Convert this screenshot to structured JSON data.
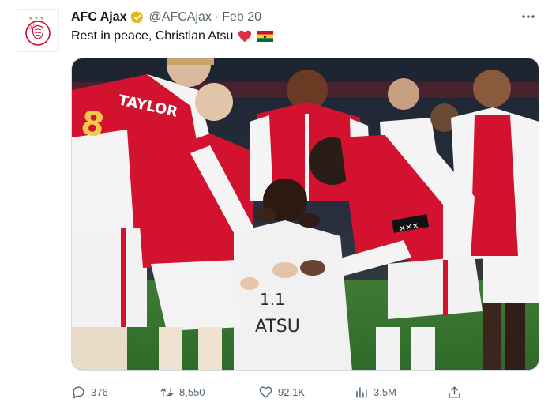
{
  "account": {
    "display_name": "AFC Ajax",
    "handle": "@AFCAjax",
    "separator": "·",
    "date": "Feb 20",
    "avatar_icon": "ajax-crest-icon",
    "verified_icon": "gold-verified-badge-icon"
  },
  "tweet": {
    "text": "Rest in peace, Christian Atsu",
    "emojis": [
      "red-heart-icon",
      "ghana-flag-icon"
    ]
  },
  "media": {
    "jersey_name": "TAYLOR",
    "shirt_text": "ATSU"
  },
  "actions": {
    "replies": "376",
    "retweets": "8,550",
    "likes": "92.1K",
    "views": "3.5M"
  },
  "colors": {
    "ajax_red": "#d2122e",
    "gold_badge": "#e2b719",
    "text_secondary": "#536471"
  }
}
